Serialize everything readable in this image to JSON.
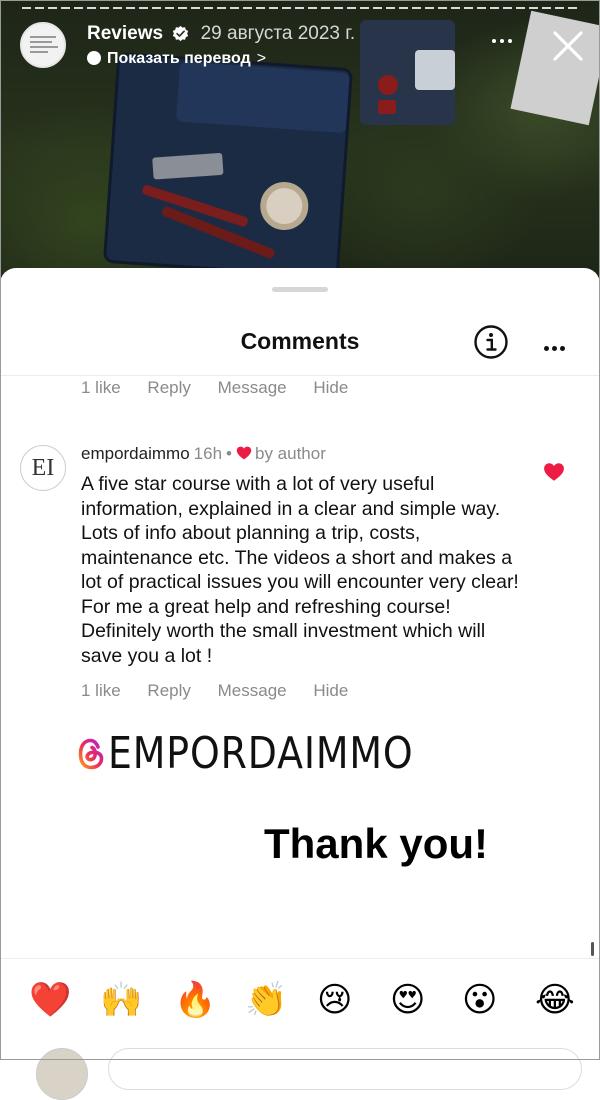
{
  "story": {
    "account": "Reviews",
    "date": "29 августа 2023 г.",
    "translate_label": "Показать перевод",
    "translate_chevron": ">"
  },
  "comments_sheet": {
    "title": "Comments",
    "first_actions": {
      "likes": "1 like",
      "reply": "Reply",
      "message": "Message",
      "hide": "Hide"
    },
    "comment": {
      "avatar_initials": "EI",
      "username": "empordaimmo",
      "time": "16h",
      "separator": "•",
      "liked_by": "by author",
      "text": "A five star course with a lot of very useful information, explained in a clear and simple way. Lots of info about planning a trip, costs, maintenance etc. The videos a short and makes a lot of practical issues you will encounter very clear! For me a great help and refreshing course! Definitely worth the small investment which will save you a lot !",
      "actions": {
        "likes": "1 like",
        "reply": "Reply",
        "message": "Message",
        "hide": "Hide"
      }
    },
    "sticker_handle": "EMPORDAIMMO",
    "thanks_text": "Thank you!",
    "emoji_reactions": [
      "❤️",
      "🙌",
      "🔥",
      "👏",
      "😢",
      "😍",
      "😮",
      "😂"
    ]
  },
  "colors": {
    "heart": "#ed1c45",
    "muted": "#8a8a8a",
    "sheet_bg": "#ffffff"
  },
  "icons": [
    "verified-badge-icon",
    "translate-bubble-icon",
    "more-dots-icon",
    "close-icon",
    "info-icon",
    "heart-icon",
    "threads-icon"
  ]
}
